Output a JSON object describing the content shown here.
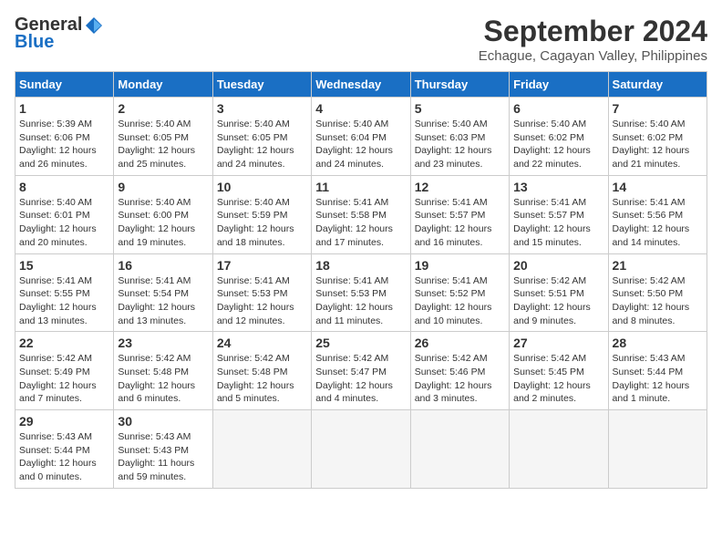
{
  "logo": {
    "general": "General",
    "blue": "Blue"
  },
  "title": "September 2024",
  "subtitle": "Echague, Cagayan Valley, Philippines",
  "weekdays": [
    "Sunday",
    "Monday",
    "Tuesday",
    "Wednesday",
    "Thursday",
    "Friday",
    "Saturday"
  ],
  "weeks": [
    [
      {
        "day": "1",
        "info": "Sunrise: 5:39 AM\nSunset: 6:06 PM\nDaylight: 12 hours\nand 26 minutes."
      },
      {
        "day": "2",
        "info": "Sunrise: 5:40 AM\nSunset: 6:05 PM\nDaylight: 12 hours\nand 25 minutes."
      },
      {
        "day": "3",
        "info": "Sunrise: 5:40 AM\nSunset: 6:05 PM\nDaylight: 12 hours\nand 24 minutes."
      },
      {
        "day": "4",
        "info": "Sunrise: 5:40 AM\nSunset: 6:04 PM\nDaylight: 12 hours\nand 24 minutes."
      },
      {
        "day": "5",
        "info": "Sunrise: 5:40 AM\nSunset: 6:03 PM\nDaylight: 12 hours\nand 23 minutes."
      },
      {
        "day": "6",
        "info": "Sunrise: 5:40 AM\nSunset: 6:02 PM\nDaylight: 12 hours\nand 22 minutes."
      },
      {
        "day": "7",
        "info": "Sunrise: 5:40 AM\nSunset: 6:02 PM\nDaylight: 12 hours\nand 21 minutes."
      }
    ],
    [
      {
        "day": "8",
        "info": "Sunrise: 5:40 AM\nSunset: 6:01 PM\nDaylight: 12 hours\nand 20 minutes."
      },
      {
        "day": "9",
        "info": "Sunrise: 5:40 AM\nSunset: 6:00 PM\nDaylight: 12 hours\nand 19 minutes."
      },
      {
        "day": "10",
        "info": "Sunrise: 5:40 AM\nSunset: 5:59 PM\nDaylight: 12 hours\nand 18 minutes."
      },
      {
        "day": "11",
        "info": "Sunrise: 5:41 AM\nSunset: 5:58 PM\nDaylight: 12 hours\nand 17 minutes."
      },
      {
        "day": "12",
        "info": "Sunrise: 5:41 AM\nSunset: 5:57 PM\nDaylight: 12 hours\nand 16 minutes."
      },
      {
        "day": "13",
        "info": "Sunrise: 5:41 AM\nSunset: 5:57 PM\nDaylight: 12 hours\nand 15 minutes."
      },
      {
        "day": "14",
        "info": "Sunrise: 5:41 AM\nSunset: 5:56 PM\nDaylight: 12 hours\nand 14 minutes."
      }
    ],
    [
      {
        "day": "15",
        "info": "Sunrise: 5:41 AM\nSunset: 5:55 PM\nDaylight: 12 hours\nand 13 minutes."
      },
      {
        "day": "16",
        "info": "Sunrise: 5:41 AM\nSunset: 5:54 PM\nDaylight: 12 hours\nand 13 minutes."
      },
      {
        "day": "17",
        "info": "Sunrise: 5:41 AM\nSunset: 5:53 PM\nDaylight: 12 hours\nand 12 minutes."
      },
      {
        "day": "18",
        "info": "Sunrise: 5:41 AM\nSunset: 5:53 PM\nDaylight: 12 hours\nand 11 minutes."
      },
      {
        "day": "19",
        "info": "Sunrise: 5:41 AM\nSunset: 5:52 PM\nDaylight: 12 hours\nand 10 minutes."
      },
      {
        "day": "20",
        "info": "Sunrise: 5:42 AM\nSunset: 5:51 PM\nDaylight: 12 hours\nand 9 minutes."
      },
      {
        "day": "21",
        "info": "Sunrise: 5:42 AM\nSunset: 5:50 PM\nDaylight: 12 hours\nand 8 minutes."
      }
    ],
    [
      {
        "day": "22",
        "info": "Sunrise: 5:42 AM\nSunset: 5:49 PM\nDaylight: 12 hours\nand 7 minutes."
      },
      {
        "day": "23",
        "info": "Sunrise: 5:42 AM\nSunset: 5:48 PM\nDaylight: 12 hours\nand 6 minutes."
      },
      {
        "day": "24",
        "info": "Sunrise: 5:42 AM\nSunset: 5:48 PM\nDaylight: 12 hours\nand 5 minutes."
      },
      {
        "day": "25",
        "info": "Sunrise: 5:42 AM\nSunset: 5:47 PM\nDaylight: 12 hours\nand 4 minutes."
      },
      {
        "day": "26",
        "info": "Sunrise: 5:42 AM\nSunset: 5:46 PM\nDaylight: 12 hours\nand 3 minutes."
      },
      {
        "day": "27",
        "info": "Sunrise: 5:42 AM\nSunset: 5:45 PM\nDaylight: 12 hours\nand 2 minutes."
      },
      {
        "day": "28",
        "info": "Sunrise: 5:43 AM\nSunset: 5:44 PM\nDaylight: 12 hours\nand 1 minute."
      }
    ],
    [
      {
        "day": "29",
        "info": "Sunrise: 5:43 AM\nSunset: 5:44 PM\nDaylight: 12 hours\nand 0 minutes."
      },
      {
        "day": "30",
        "info": "Sunrise: 5:43 AM\nSunset: 5:43 PM\nDaylight: 11 hours\nand 59 minutes."
      },
      {
        "day": "",
        "info": ""
      },
      {
        "day": "",
        "info": ""
      },
      {
        "day": "",
        "info": ""
      },
      {
        "day": "",
        "info": ""
      },
      {
        "day": "",
        "info": ""
      }
    ]
  ]
}
